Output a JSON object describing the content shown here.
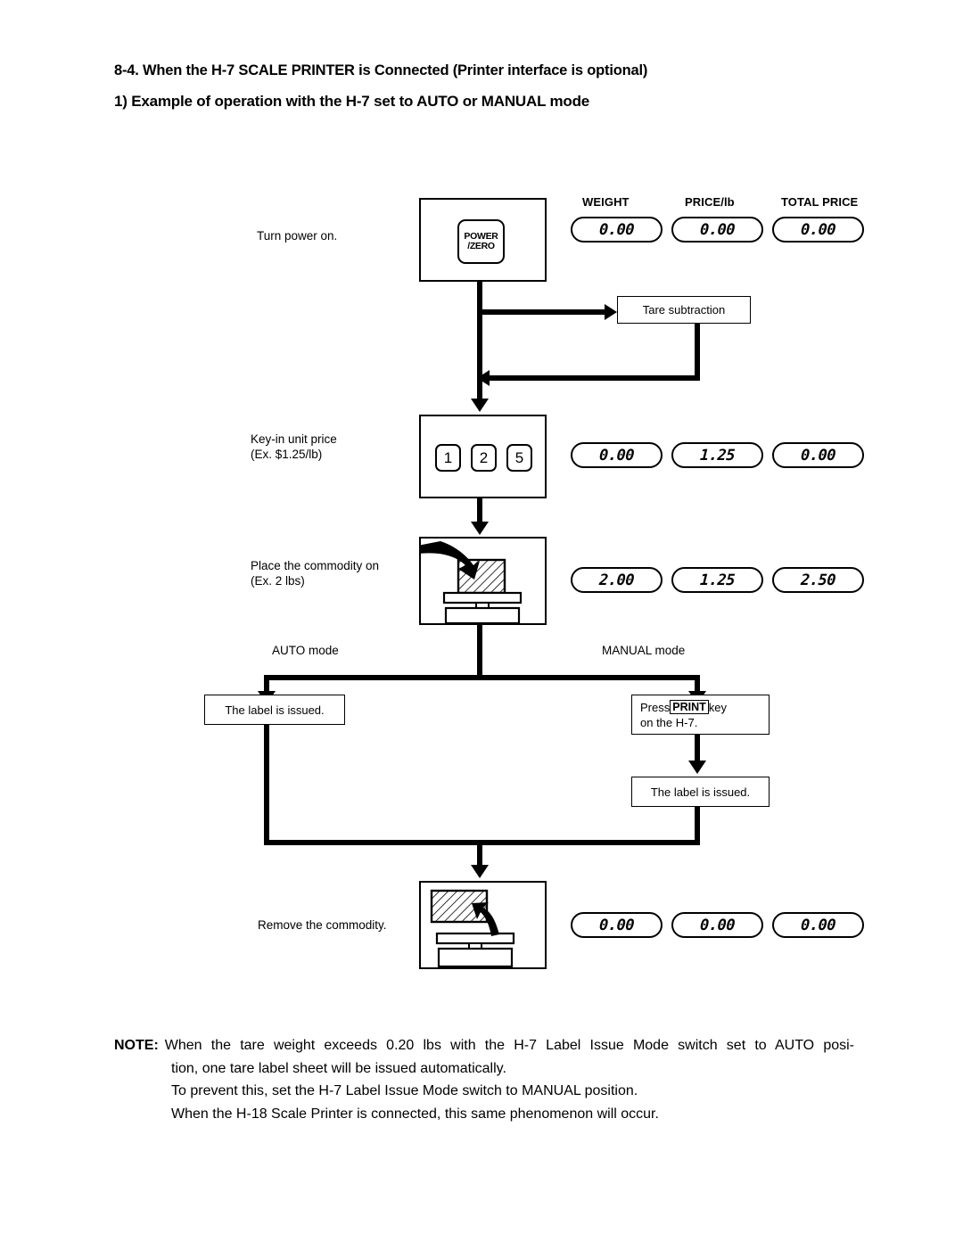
{
  "headings": {
    "section": "8-4.  When the H-7 SCALE PRINTER is Connected (Printer interface is optional)",
    "subsection": "1) Example of operation with the H-7 set to AUTO or MANUAL mode"
  },
  "display_headers": {
    "weight": "WEIGHT",
    "price": "PRICE/lb",
    "total": "TOTAL PRICE"
  },
  "steps": [
    {
      "caption": "Turn power on.",
      "key_label_line1": "POWER",
      "key_label_line2": "/ZERO",
      "weight": "0.00",
      "price": "0.00",
      "total": "0.00"
    },
    {
      "caption_line1": "Key-in unit price",
      "caption_line2": "(Ex. $1.25/lb)",
      "keys": [
        "1",
        "2",
        "5"
      ],
      "weight": "0.00",
      "price": "1.25",
      "total": "0.00"
    },
    {
      "caption_line1": "Place the commodity on",
      "caption_line2": "(Ex. 2 lbs)",
      "weight": "2.00",
      "price": "1.25",
      "total": "2.50"
    },
    {
      "caption": "Remove the commodity.",
      "weight": "0.00",
      "price": "0.00",
      "total": "0.00"
    }
  ],
  "tare_box": "Tare subtraction",
  "branches": {
    "auto_label": "AUTO mode",
    "manual_label": "MANUAL mode",
    "auto_result": "The label is issued.",
    "manual_press_prefix": "Press",
    "manual_press_key": "PRINT",
    "manual_press_suffix": "key",
    "manual_press_line2": "on the H-7.",
    "manual_result": "The label is issued."
  },
  "note": {
    "tag": "NOTE:",
    "line1": "When the tare weight exceeds 0.20 lbs with the H-7 Label Issue Mode switch set to AUTO posi-",
    "line2": "tion, one tare label sheet will be issued automatically.",
    "line3": "To prevent this, set the H-7 Label Issue Mode switch to MANUAL position.",
    "line4": "When the H-18 Scale Printer is connected, this same phenomenon will occur."
  }
}
